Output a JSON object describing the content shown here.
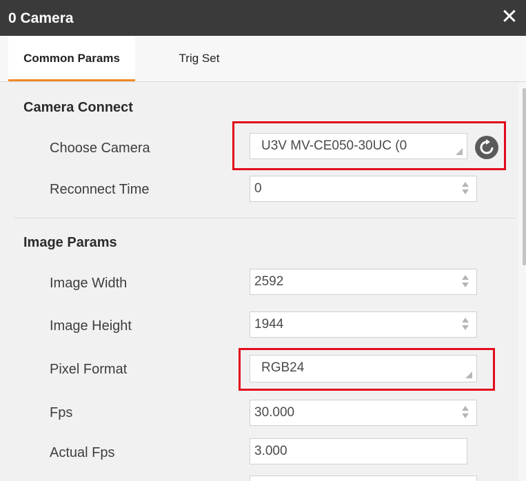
{
  "window": {
    "title": "0 Camera",
    "close_glyph": "✕"
  },
  "tabs": [
    {
      "label": "Common Params",
      "active": true
    },
    {
      "label": "Trig Set",
      "active": false
    }
  ],
  "sections": {
    "camera_connect": {
      "title": "Camera Connect",
      "choose_camera": {
        "label": "Choose Camera",
        "value": "U3V MV-CE050-30UC (0"
      },
      "reconnect_time": {
        "label": "Reconnect Time",
        "value": "0"
      }
    },
    "image_params": {
      "title": "Image Params",
      "image_width": {
        "label": "Image Width",
        "value": "2592"
      },
      "image_height": {
        "label": "Image Height",
        "value": "1944"
      },
      "pixel_format": {
        "label": "Pixel Format",
        "value": "RGB24"
      },
      "fps": {
        "label": "Fps",
        "value": "30.000"
      },
      "actual_fps": {
        "label": "Actual Fps",
        "value": "3.000"
      }
    }
  },
  "icons": {
    "close": "close-icon",
    "refresh": "refresh-icon"
  },
  "colors": {
    "accent": "#f08a24",
    "highlight": "#e20a1b",
    "titlebar": "#3a3a3a"
  }
}
